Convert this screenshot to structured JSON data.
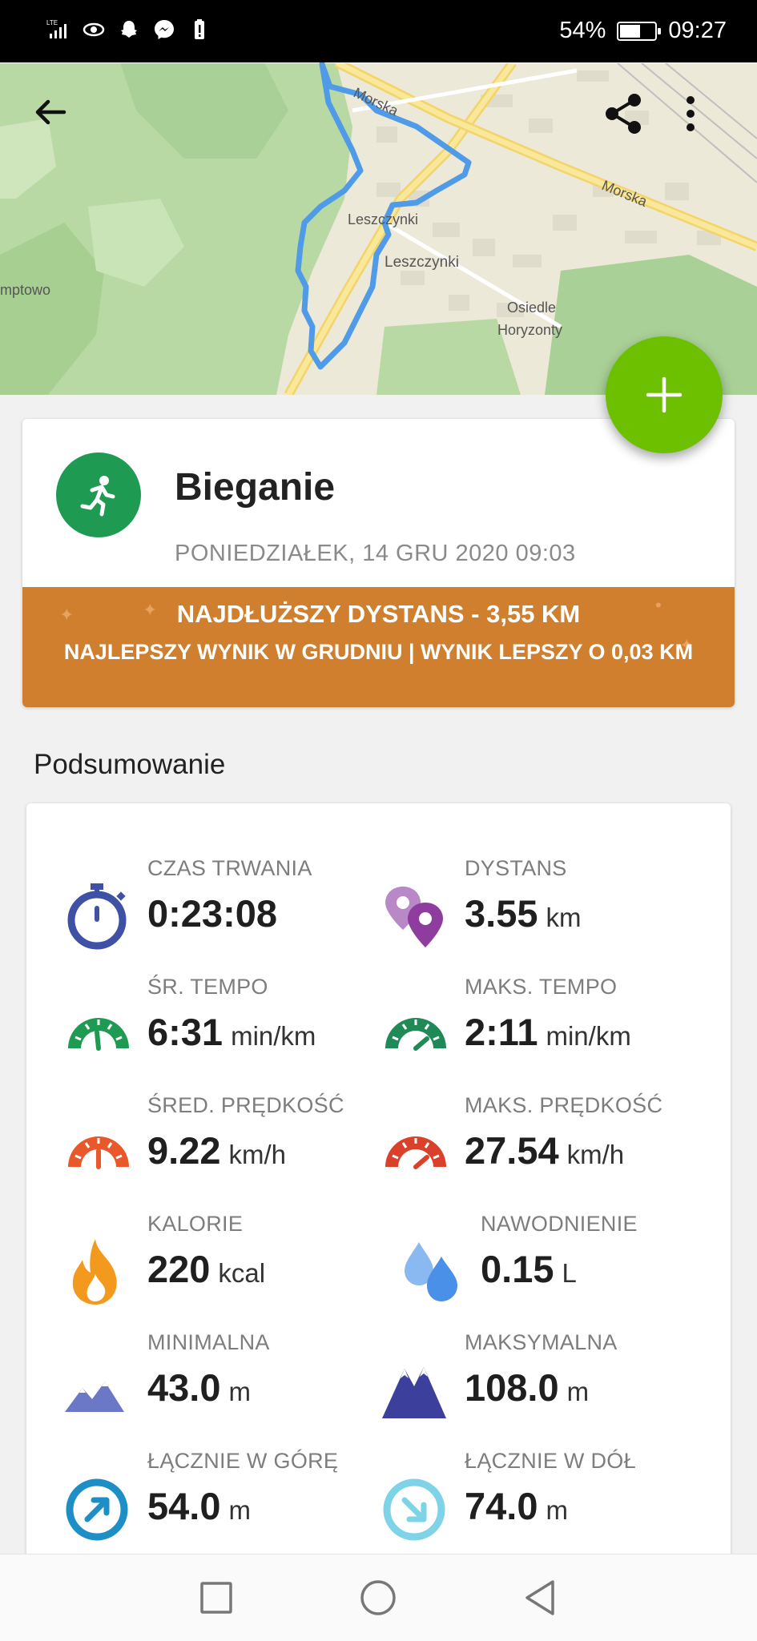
{
  "status_bar": {
    "network": "LTE",
    "battery_percent": "54%",
    "battery_level": 0.54,
    "time": "09:27"
  },
  "map": {
    "labels": {
      "street_morska_top": "Morska",
      "street_morska_right": "Morska",
      "district1": "Leszczynki",
      "district2": "Leszczynki",
      "estate_line1": "Osiedle",
      "estate_line2": "Horyzonty",
      "left_edge": "mptowo"
    },
    "route_color": "#4f9be8"
  },
  "activity": {
    "title": "Bieganie",
    "date": "PONIEDZIAŁEK, 14 GRU 2020 09:03",
    "icon": "running-icon",
    "icon_color": "#1f9a52"
  },
  "banner": {
    "line1": "NAJDŁUŻSZY DYSTANS  -  3,55 KM",
    "line2": "NAJLEPSZY WYNIK W GRUDNIU  |  WYNIK LEPSZY O 0,03 KM",
    "color": "#cf7f2e"
  },
  "section_title": "Podsumowanie",
  "stats": [
    {
      "label": "CZAS TRWANIA",
      "value": "0:23:08",
      "unit": "",
      "icon": "stopwatch-icon",
      "color": "#3f51a5"
    },
    {
      "label": "DYSTANS",
      "value": "3.55",
      "unit": "km",
      "icon": "location-pins-icon",
      "color": "#8e3c9e"
    },
    {
      "label": "ŚR. TEMPO",
      "value": "6:31",
      "unit": "min/km",
      "icon": "tempo-gauge-icon",
      "color": "#1f9a52"
    },
    {
      "label": "MAKS. TEMPO",
      "value": "2:11",
      "unit": "min/km",
      "icon": "max-tempo-gauge-icon",
      "color": "#1f8a55"
    },
    {
      "label": "ŚRED. PRĘDKOŚĆ",
      "value": "9.22",
      "unit": "km/h",
      "icon": "speed-gauge-icon",
      "color": "#e8582a"
    },
    {
      "label": "MAKS. PRĘDKOŚĆ",
      "value": "27.54",
      "unit": "km/h",
      "icon": "max-speed-gauge-icon",
      "color": "#d9412a"
    },
    {
      "label": "KALORIE",
      "value": "220",
      "unit": "kcal",
      "icon": "flame-icon",
      "color": "#f39a1e"
    },
    {
      "label": "NAWODNIENIE",
      "value": "0.15",
      "unit": "L",
      "icon": "water-drops-icon",
      "color": "#4a8fe8"
    },
    {
      "label": "MINIMALNA",
      "value": "43.0",
      "unit": "m",
      "icon": "low-mountains-icon",
      "color": "#6b78c8"
    },
    {
      "label": "MAKSYMALNA",
      "value": "108.0",
      "unit": "m",
      "icon": "high-mountains-icon",
      "color": "#3d3f9c"
    },
    {
      "label": "ŁĄCZNIE W GÓRĘ",
      "value": "54.0",
      "unit": "m",
      "icon": "ascent-arrow-icon",
      "color": "#1e8fc6"
    },
    {
      "label": "ŁĄCZNIE W DÓŁ",
      "value": "74.0",
      "unit": "m",
      "icon": "descent-arrow-icon",
      "color": "#7fd3e6"
    }
  ]
}
